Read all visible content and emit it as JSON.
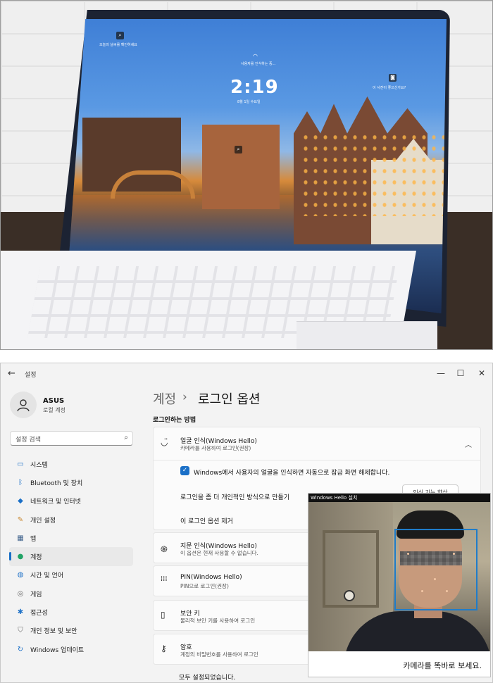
{
  "photo": {
    "lock_screen": {
      "time": "2:19",
      "date": "8월 1일 수요일",
      "top_left_hint": "오늘의 날씨를 확인하세요",
      "top_center_hint": "사용자를 인식하는 중...",
      "top_right_hint": "이 사진이 좋으신가요?"
    }
  },
  "window": {
    "title": "설정",
    "controls": {
      "minimize": "—",
      "maximize": "☐",
      "close": "✕"
    },
    "back_icon": "←"
  },
  "user": {
    "name": "ASUS",
    "account_type": "로컬 계정"
  },
  "search": {
    "placeholder": "설정 검색",
    "icon": "search-icon"
  },
  "nav": {
    "items": [
      {
        "label": "시스템",
        "icon": "system-icon"
      },
      {
        "label": "Bluetooth 및 장치",
        "icon": "bluetooth-icon"
      },
      {
        "label": "네트워크 및 인터넷",
        "icon": "network-icon"
      },
      {
        "label": "개인 설정",
        "icon": "brush-icon"
      },
      {
        "label": "앱",
        "icon": "apps-icon"
      },
      {
        "label": "계정",
        "icon": "account-icon",
        "active": true
      },
      {
        "label": "시간 및 언어",
        "icon": "globe-icon"
      },
      {
        "label": "게임",
        "icon": "gamepad-icon"
      },
      {
        "label": "접근성",
        "icon": "accessibility-icon"
      },
      {
        "label": "개인 정보 및 보안",
        "icon": "shield-icon"
      },
      {
        "label": "Windows 업데이트",
        "icon": "update-icon"
      }
    ]
  },
  "breadcrumb": {
    "parent": "계정",
    "separator": "›",
    "current": "로그인 옵션"
  },
  "section_title": "로그인하는 방법",
  "face": {
    "title": "얼굴 인식(Windows Hello)",
    "subtitle": "카메라를 사용하여 로그인(권장)",
    "checkbox_label": "Windows에서 사용자의 얼굴을 인식하면 자동으로 잠금 화면 해제합니다.",
    "improve_label": "로그인을 좀 더 개인적인 방식으로 만들기",
    "remove_label": "이 로그인 옵션 제거",
    "setup_button": "인식 기능 향상"
  },
  "fingerprint": {
    "title": "지문 인식(Windows Hello)",
    "subtitle": "이 옵션은 현재 사용할 수 없습니다."
  },
  "pin": {
    "title": "PIN(Windows Hello)",
    "subtitle": "PIN으로 로그인(권장)"
  },
  "security_key": {
    "title": "보안 키",
    "subtitle": "물리적 보안 키를 사용하여 로그인"
  },
  "password": {
    "title": "암호",
    "subtitle": "계정의 비밀번호를 사용하여 로그인"
  },
  "lower_row": "모두 설정되었습니다.",
  "hello_overlay": {
    "title": "Windows Hello 설치",
    "message": "카메라를 똑바로 보세요."
  },
  "colors": {
    "accent": "#1a6fc7",
    "face_box": "#1f7cc9"
  }
}
